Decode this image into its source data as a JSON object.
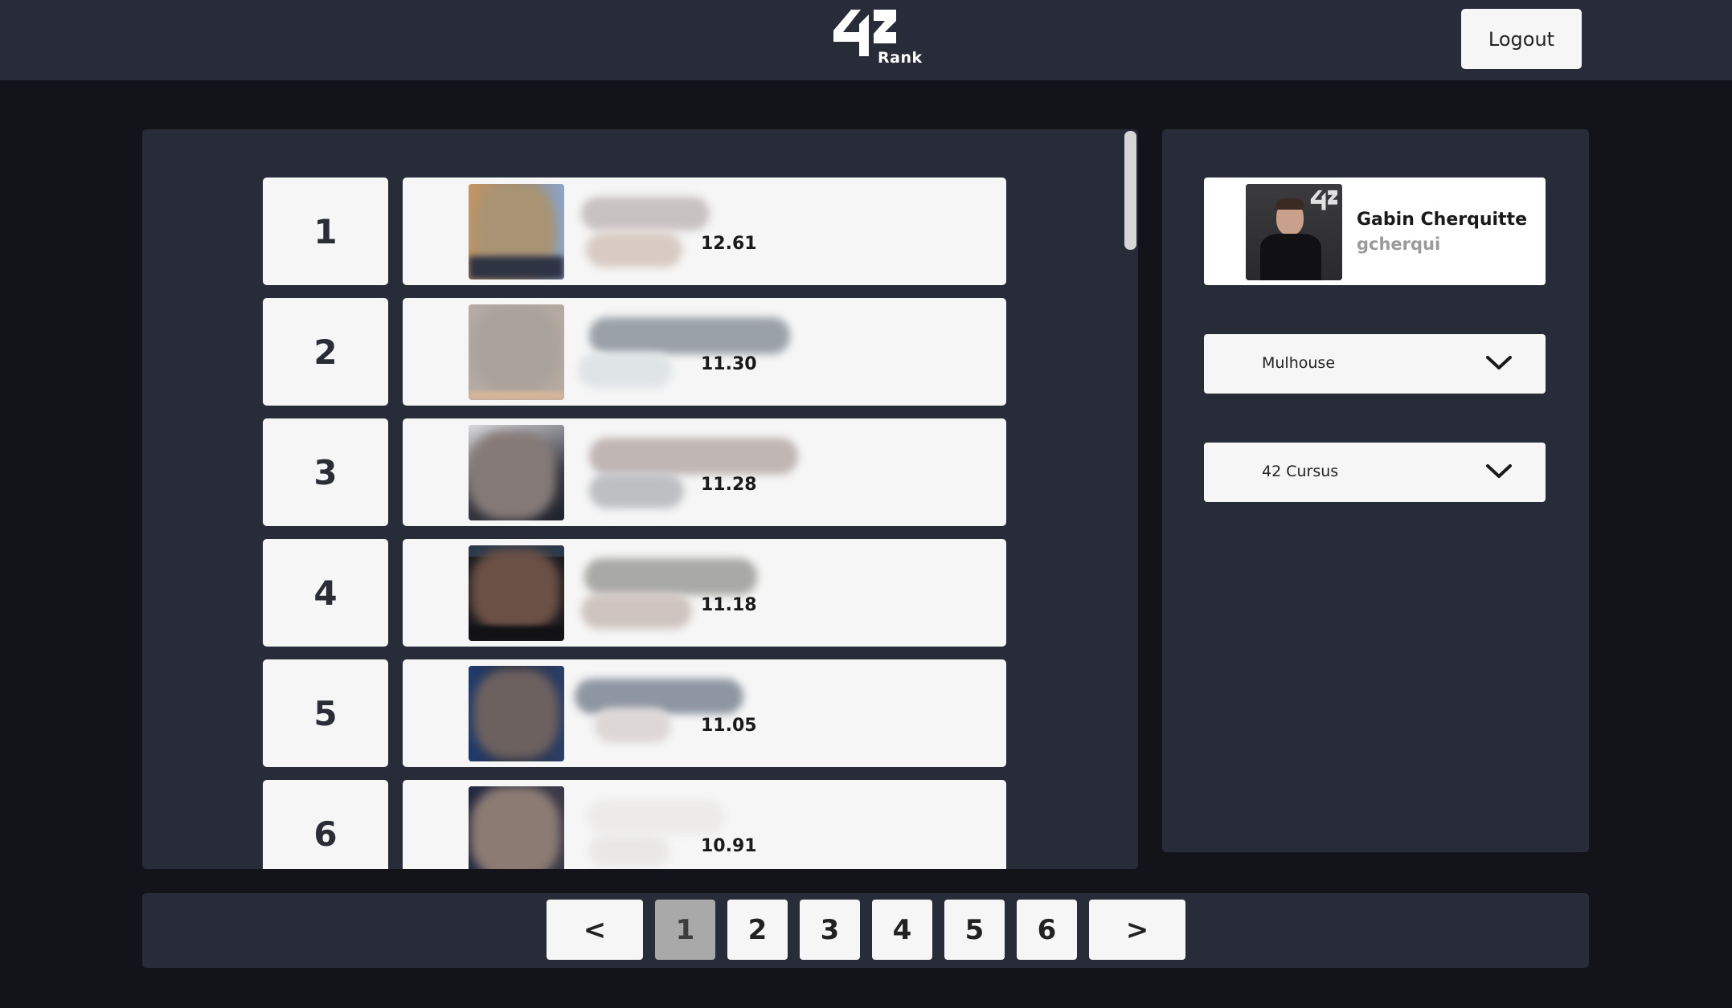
{
  "header": {
    "logo_text": "42",
    "logo_subtitle": "Rank",
    "logout_label": "Logout"
  },
  "leaderboard": {
    "entries": [
      {
        "rank": "1",
        "level": "12.61"
      },
      {
        "rank": "2",
        "level": "11.30"
      },
      {
        "rank": "3",
        "level": "11.28"
      },
      {
        "rank": "4",
        "level": "11.18"
      },
      {
        "rank": "5",
        "level": "11.05"
      },
      {
        "rank": "6",
        "level": "10.91"
      }
    ]
  },
  "profile": {
    "name": "Gabin Cherquitte",
    "login": "gcherqui"
  },
  "filters": {
    "campus": "Mulhouse",
    "cursus": "42 Cursus"
  },
  "pagination": {
    "prev": "<",
    "next": ">",
    "pages": [
      "1",
      "2",
      "3",
      "4",
      "5",
      "6"
    ],
    "current": "1"
  },
  "colors": {
    "background": "#13141a",
    "panel": "#282b38",
    "card": "#f6f6f6",
    "active_page": "#a9a9a9"
  },
  "icons": [
    "chevron-down-icon",
    "logo-42-icon"
  ]
}
